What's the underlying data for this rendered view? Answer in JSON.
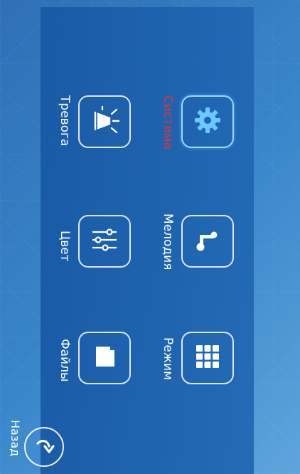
{
  "menu": {
    "items": [
      {
        "key": "alarm",
        "label": "Тревога",
        "icon": "siren-icon"
      },
      {
        "key": "system",
        "label": "Система",
        "icon": "gear-icon",
        "selected": true
      },
      {
        "key": "color",
        "label": "Цвет",
        "icon": "sliders-icon"
      },
      {
        "key": "melody",
        "label": "Мелодия",
        "icon": "music-note-icon"
      },
      {
        "key": "files",
        "label": "Файлы",
        "icon": "file-icon"
      },
      {
        "key": "mode",
        "label": "Режим",
        "icon": "grid-icon"
      }
    ]
  },
  "back": {
    "label": "Назад",
    "icon": "back-arrow-icon"
  },
  "colors": {
    "selected_label": "#e8313a",
    "label": "#ffffff",
    "panel": "#1f63b0"
  }
}
